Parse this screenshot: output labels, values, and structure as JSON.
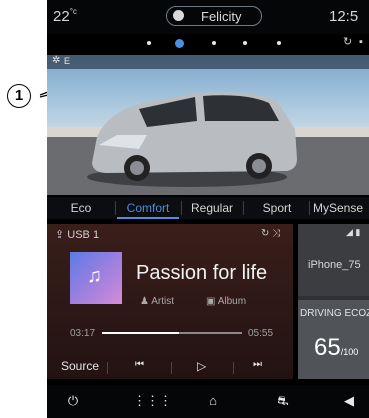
{
  "status": {
    "temperature": "22",
    "temperature_unit": "°c",
    "profile_name": "Felicity",
    "clock": "12:5"
  },
  "page_indicator": {
    "count": 5,
    "active": 1
  },
  "hero": {
    "label": "E"
  },
  "drive_modes": [
    "Eco",
    "Comfort",
    "Regular",
    "Sport",
    "MySense"
  ],
  "drive_mode_selected": "Comfort",
  "media": {
    "source": "USB 1",
    "track_title": "Passion for life",
    "artist": "Artist",
    "album": "Album",
    "elapsed": "03:17",
    "duration": "05:55",
    "progress": 0.55,
    "controls": {
      "source": "Source",
      "prev": "⏮",
      "play": "▷",
      "next": "⏭"
    }
  },
  "widget": {
    "phone": "iPhone_75",
    "eco_label": "DRIVING ECOZ",
    "eco_score": "65",
    "eco_unit": "/100"
  },
  "nav_icons": [
    "power-icon",
    "apps-icon",
    "home-icon",
    "assist-icon",
    "volume-icon"
  ],
  "callout": {
    "number": "1"
  },
  "colors": {
    "accent": "#4a8fe0",
    "media_bg": "#3a1e1a"
  }
}
